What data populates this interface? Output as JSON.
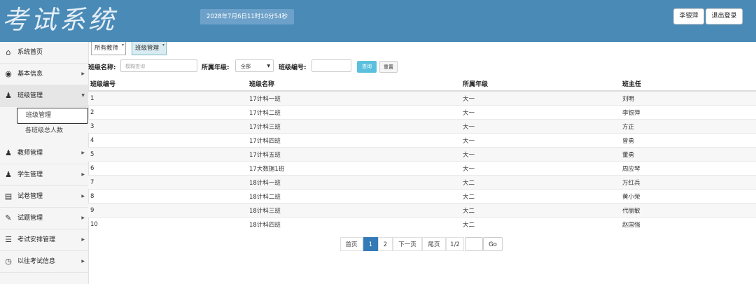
{
  "header": {
    "app_title": "考试系统",
    "datetime": "2028年7月6日11时10分54秒",
    "user_button": "李银萍",
    "logout_button": "退出登录"
  },
  "sidebar": {
    "items": [
      {
        "label": "系统首页",
        "icon": "home-icon"
      },
      {
        "label": "基本信息",
        "icon": "info-icon"
      },
      {
        "label": "班级管理",
        "icon": "users-icon"
      },
      {
        "label": "教师管理",
        "icon": "teacher-icon"
      },
      {
        "label": "学生管理",
        "icon": "student-icon"
      },
      {
        "label": "试卷管理",
        "icon": "paper-icon"
      },
      {
        "label": "试题管理",
        "icon": "question-icon"
      },
      {
        "label": "考试安排管理",
        "icon": "books-icon"
      },
      {
        "label": "以往考试信息",
        "icon": "clock-icon"
      }
    ],
    "sub_items": [
      "班级管理",
      "各班级总人数"
    ]
  },
  "tabs": [
    "所有教师",
    "班级管理"
  ],
  "filters": {
    "class_name_label": "班级名称:",
    "class_name_placeholder": "模糊查询",
    "grade_label": "所属年级:",
    "grade_value": "全部",
    "class_no_label": "班级编号:",
    "query_button": "查询",
    "reset_button": "重置"
  },
  "table": {
    "headers": [
      "班级编号",
      "班级名称",
      "所属年级",
      "班主任"
    ],
    "rows": [
      [
        "1",
        "17计科一班",
        "大一",
        "刘明"
      ],
      [
        "2",
        "17计科二班",
        "大一",
        "李银萍"
      ],
      [
        "3",
        "17计科三班",
        "大一",
        "方正"
      ],
      [
        "4",
        "17计科四班",
        "大一",
        "曾勇"
      ],
      [
        "5",
        "17计科五班",
        "大一",
        "董勇"
      ],
      [
        "6",
        "17大数据1班",
        "大一",
        "周应琴"
      ],
      [
        "7",
        "18计科一班",
        "大二",
        "万红兵"
      ],
      [
        "8",
        "18计科二班",
        "大二",
        "黄小荣"
      ],
      [
        "9",
        "18计科三班",
        "大二",
        "代丽敏"
      ],
      [
        "10",
        "18计科四班",
        "大二",
        "赵国强"
      ]
    ]
  },
  "pagination": {
    "first": "首页",
    "page1": "1",
    "page2": "2",
    "next": "下一页",
    "last": "尾页",
    "page_info": "1/2",
    "go": "Go"
  }
}
